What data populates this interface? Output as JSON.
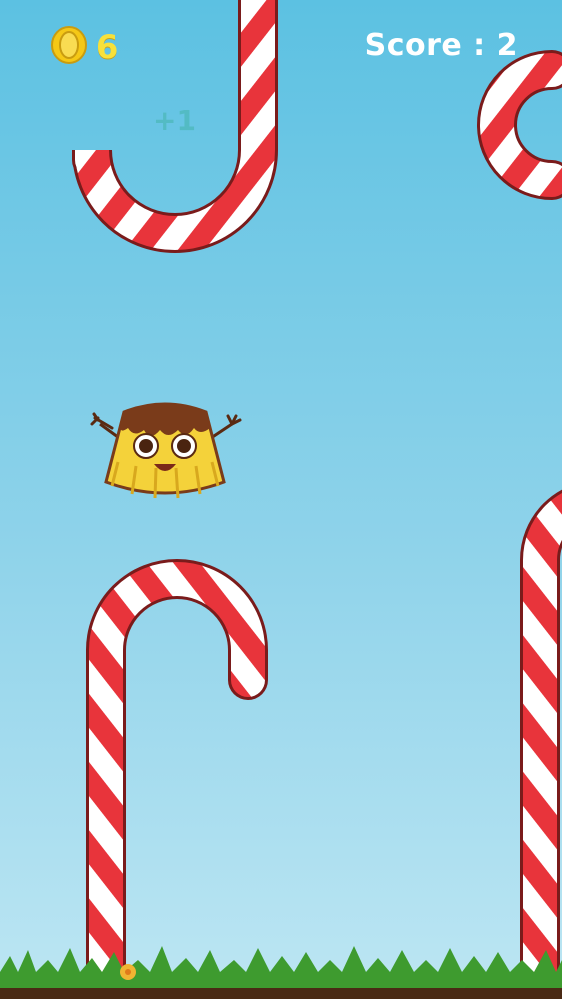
{
  "hud": {
    "coin_icon": "gold-coin-icon",
    "coin_count": "6",
    "score_text": "Score : 2"
  },
  "floating_text": "+1",
  "colors": {
    "sky_top": "#5cc1e2",
    "sky_bottom": "#bde6f3",
    "cane_red": "#e8343b",
    "cane_white": "#ffffff",
    "coin": "#f5c816",
    "grass": "#3e9b2f",
    "pudding": "#f4d23a",
    "caramel": "#7a3b1a"
  }
}
